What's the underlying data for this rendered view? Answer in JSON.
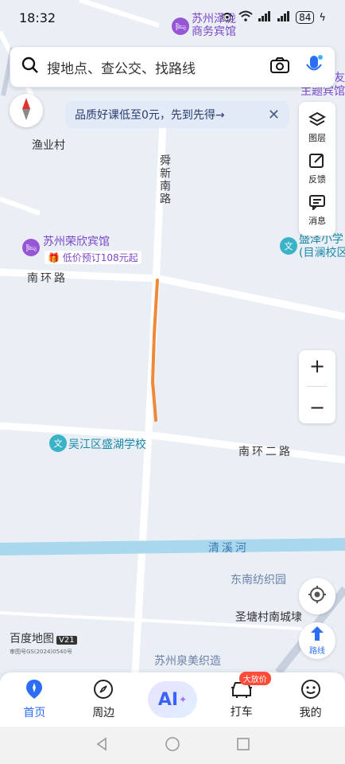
{
  "status_bar": {
    "time": "18:32",
    "battery": "84"
  },
  "search": {
    "placeholder": "搜地点、查公交、找路线"
  },
  "promo": {
    "text": "品质好课低至0元，先到先得→",
    "close": "✕"
  },
  "side_tools": [
    {
      "label": "图层",
      "icon": "layers-icon"
    },
    {
      "label": "反馈",
      "icon": "feedback-icon"
    },
    {
      "label": "消息",
      "icon": "message-icon"
    }
  ],
  "zoom": {
    "in": "+",
    "out": "−"
  },
  "route_button": {
    "label": "路线"
  },
  "map": {
    "villages": [
      "渔业村"
    ],
    "roads": {
      "shunxin": "舜新南路",
      "nanhuan": "南环路",
      "nanhuan2": "南环二路"
    },
    "river": "清溪河",
    "pois": {
      "hotel_top": "苏州泽泷\n商务宾馆",
      "hotel_rongxin": "苏州荣欣宾馆",
      "hotel_rongxin_deal": "低价预订108元起",
      "school_shenghu": "吴江区盛湖学校",
      "school_shengze": "盛泽小学\n(目澜校区",
      "theme_hotel": "友\n主题宾馆",
      "textile_park": "东南纺织园",
      "shengtang": "圣塘村南城埭",
      "quanmei": "苏州泉美织造"
    }
  },
  "logo": {
    "name": "百度地图",
    "version": "V21",
    "gs": "审图号GS(2024)0540号"
  },
  "tabbar": {
    "home": "首页",
    "nearby": "周边",
    "ai": "AI",
    "taxi": "打车",
    "taxi_badge": "大放价",
    "mine": "我的"
  },
  "colors": {
    "accent": "#2b6ef5",
    "route": "#f0883a",
    "water": "#a9d7ee"
  }
}
